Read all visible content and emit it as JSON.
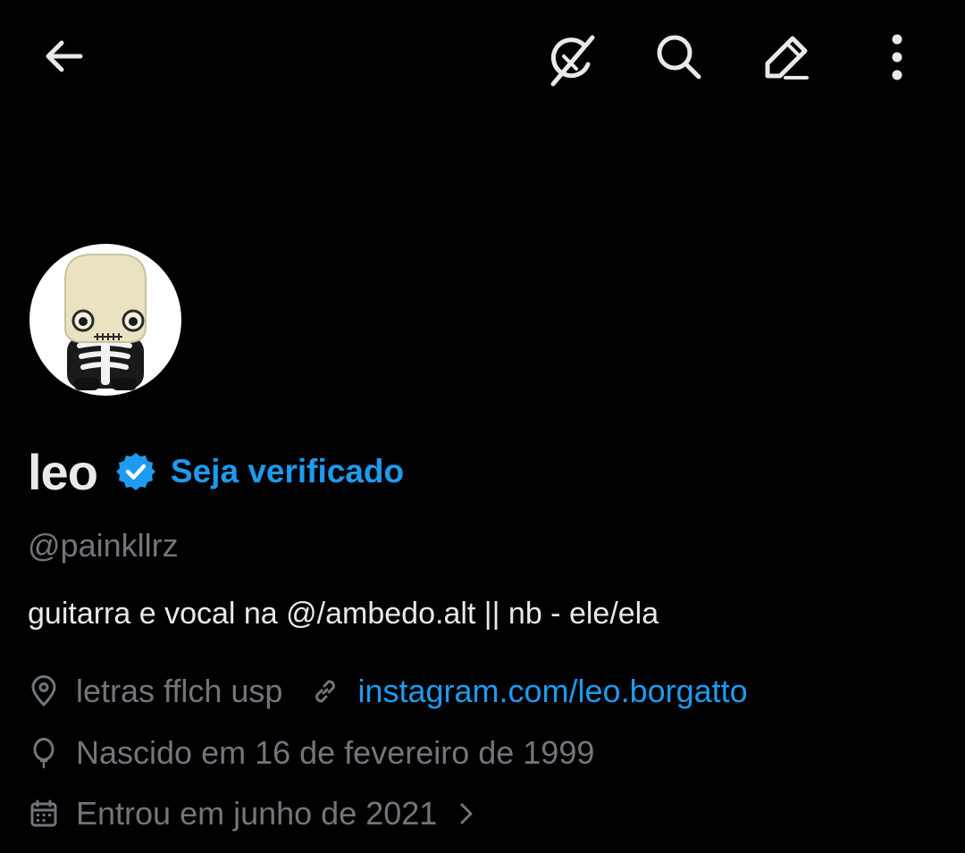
{
  "toolbar": {
    "back_icon": "arrow-left-icon",
    "grok_icon": "grok-icon",
    "search_icon": "search-icon",
    "edit_icon": "edit-pencil-icon",
    "more_icon": "more-vertical-icon"
  },
  "profile": {
    "display_name": "leo",
    "verified_icon": "verified-badge-icon",
    "get_verified_label": "Seja verificado",
    "handle": "@painkllrz",
    "bio": "guitarra e vocal na @/ambedo.alt || nb - ele/ela",
    "location": "letras fflch usp",
    "website": "instagram.com/leo.borgatto",
    "birth": "Nascido em 16 de fevereiro de 1999",
    "joined": "Entrou em junho de 2021"
  },
  "colors": {
    "background": "#000000",
    "primary_text": "#e7e9ea",
    "secondary_text": "#71767b",
    "accent": "#1d9bf0"
  }
}
